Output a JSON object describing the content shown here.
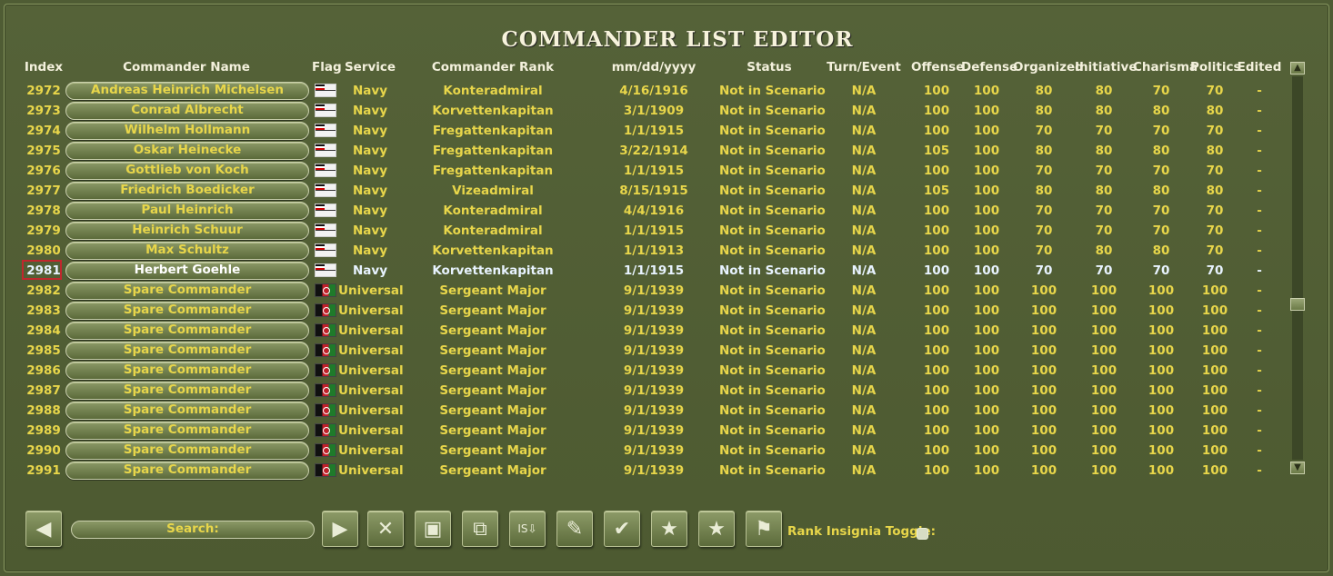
{
  "title": "COMMANDER LIST EDITOR",
  "columns": {
    "index": "Index",
    "name": "Commander Name",
    "flag": "Flag",
    "service": "Service",
    "rank": "Commander Rank",
    "date": "mm/dd/yyyy",
    "status": "Status",
    "turn": "Turn/Event",
    "offense": "Offense",
    "defense": "Defense",
    "organized": "Organized",
    "initiative": "Initiative",
    "charisma": "Charisma",
    "politics": "Politics",
    "edited": "Edited"
  },
  "selected_index": "2981",
  "rows": [
    {
      "index": "2972",
      "name": "Andreas Heinrich Michelsen",
      "flag": "navy",
      "service": "Navy",
      "rank": "Konteradmiral",
      "date": "4/16/1916",
      "status": "Not in Scenario",
      "turn": "N/A",
      "offense": "100",
      "defense": "100",
      "organized": "80",
      "initiative": "80",
      "charisma": "70",
      "politics": "70",
      "edited": "-"
    },
    {
      "index": "2973",
      "name": "Conrad Albrecht",
      "flag": "navy",
      "service": "Navy",
      "rank": "Korvettenkapitan",
      "date": "3/1/1909",
      "status": "Not in Scenario",
      "turn": "N/A",
      "offense": "100",
      "defense": "100",
      "organized": "80",
      "initiative": "80",
      "charisma": "80",
      "politics": "80",
      "edited": "-"
    },
    {
      "index": "2974",
      "name": "Wilhelm Hollmann",
      "flag": "navy",
      "service": "Navy",
      "rank": "Fregattenkapitan",
      "date": "1/1/1915",
      "status": "Not in Scenario",
      "turn": "N/A",
      "offense": "100",
      "defense": "100",
      "organized": "70",
      "initiative": "70",
      "charisma": "70",
      "politics": "70",
      "edited": "-"
    },
    {
      "index": "2975",
      "name": "Oskar Heinecke",
      "flag": "navy",
      "service": "Navy",
      "rank": "Fregattenkapitan",
      "date": "3/22/1914",
      "status": "Not in Scenario",
      "turn": "N/A",
      "offense": "105",
      "defense": "100",
      "organized": "80",
      "initiative": "80",
      "charisma": "80",
      "politics": "80",
      "edited": "-"
    },
    {
      "index": "2976",
      "name": "Gottlieb von Koch",
      "flag": "navy",
      "service": "Navy",
      "rank": "Fregattenkapitan",
      "date": "1/1/1915",
      "status": "Not in Scenario",
      "turn": "N/A",
      "offense": "100",
      "defense": "100",
      "organized": "70",
      "initiative": "70",
      "charisma": "70",
      "politics": "70",
      "edited": "-"
    },
    {
      "index": "2977",
      "name": "Friedrich Boedicker",
      "flag": "navy",
      "service": "Navy",
      "rank": "Vizeadmiral",
      "date": "8/15/1915",
      "status": "Not in Scenario",
      "turn": "N/A",
      "offense": "105",
      "defense": "100",
      "organized": "80",
      "initiative": "80",
      "charisma": "80",
      "politics": "80",
      "edited": "-"
    },
    {
      "index": "2978",
      "name": "Paul Heinrich",
      "flag": "navy",
      "service": "Navy",
      "rank": "Konteradmiral",
      "date": "4/4/1916",
      "status": "Not in Scenario",
      "turn": "N/A",
      "offense": "100",
      "defense": "100",
      "organized": "70",
      "initiative": "70",
      "charisma": "70",
      "politics": "70",
      "edited": "-"
    },
    {
      "index": "2979",
      "name": "Heinrich Schuur",
      "flag": "navy",
      "service": "Navy",
      "rank": "Konteradmiral",
      "date": "1/1/1915",
      "status": "Not in Scenario",
      "turn": "N/A",
      "offense": "100",
      "defense": "100",
      "organized": "70",
      "initiative": "70",
      "charisma": "70",
      "politics": "70",
      "edited": "-"
    },
    {
      "index": "2980",
      "name": "Max Schultz",
      "flag": "navy",
      "service": "Navy",
      "rank": "Korvettenkapitan",
      "date": "1/1/1913",
      "status": "Not in Scenario",
      "turn": "N/A",
      "offense": "100",
      "defense": "100",
      "organized": "70",
      "initiative": "80",
      "charisma": "80",
      "politics": "70",
      "edited": "-"
    },
    {
      "index": "2981",
      "name": "Herbert Goehle",
      "flag": "navy",
      "service": "Navy",
      "rank": "Korvettenkapitan",
      "date": "1/1/1915",
      "status": "Not in Scenario",
      "turn": "N/A",
      "offense": "100",
      "defense": "100",
      "organized": "70",
      "initiative": "70",
      "charisma": "70",
      "politics": "70",
      "edited": "-"
    },
    {
      "index": "2982",
      "name": "Spare Commander",
      "flag": "afg",
      "service": "Universal",
      "rank": "Sergeant Major",
      "date": "9/1/1939",
      "status": "Not in Scenario",
      "turn": "N/A",
      "offense": "100",
      "defense": "100",
      "organized": "100",
      "initiative": "100",
      "charisma": "100",
      "politics": "100",
      "edited": "-"
    },
    {
      "index": "2983",
      "name": "Spare Commander",
      "flag": "afg",
      "service": "Universal",
      "rank": "Sergeant Major",
      "date": "9/1/1939",
      "status": "Not in Scenario",
      "turn": "N/A",
      "offense": "100",
      "defense": "100",
      "organized": "100",
      "initiative": "100",
      "charisma": "100",
      "politics": "100",
      "edited": "-"
    },
    {
      "index": "2984",
      "name": "Spare Commander",
      "flag": "afg",
      "service": "Universal",
      "rank": "Sergeant Major",
      "date": "9/1/1939",
      "status": "Not in Scenario",
      "turn": "N/A",
      "offense": "100",
      "defense": "100",
      "organized": "100",
      "initiative": "100",
      "charisma": "100",
      "politics": "100",
      "edited": "-"
    },
    {
      "index": "2985",
      "name": "Spare Commander",
      "flag": "afg",
      "service": "Universal",
      "rank": "Sergeant Major",
      "date": "9/1/1939",
      "status": "Not in Scenario",
      "turn": "N/A",
      "offense": "100",
      "defense": "100",
      "organized": "100",
      "initiative": "100",
      "charisma": "100",
      "politics": "100",
      "edited": "-"
    },
    {
      "index": "2986",
      "name": "Spare Commander",
      "flag": "afg",
      "service": "Universal",
      "rank": "Sergeant Major",
      "date": "9/1/1939",
      "status": "Not in Scenario",
      "turn": "N/A",
      "offense": "100",
      "defense": "100",
      "organized": "100",
      "initiative": "100",
      "charisma": "100",
      "politics": "100",
      "edited": "-"
    },
    {
      "index": "2987",
      "name": "Spare Commander",
      "flag": "afg",
      "service": "Universal",
      "rank": "Sergeant Major",
      "date": "9/1/1939",
      "status": "Not in Scenario",
      "turn": "N/A",
      "offense": "100",
      "defense": "100",
      "organized": "100",
      "initiative": "100",
      "charisma": "100",
      "politics": "100",
      "edited": "-"
    },
    {
      "index": "2988",
      "name": "Spare Commander",
      "flag": "afg",
      "service": "Universal",
      "rank": "Sergeant Major",
      "date": "9/1/1939",
      "status": "Not in Scenario",
      "turn": "N/A",
      "offense": "100",
      "defense": "100",
      "organized": "100",
      "initiative": "100",
      "charisma": "100",
      "politics": "100",
      "edited": "-"
    },
    {
      "index": "2989",
      "name": "Spare Commander",
      "flag": "afg",
      "service": "Universal",
      "rank": "Sergeant Major",
      "date": "9/1/1939",
      "status": "Not in Scenario",
      "turn": "N/A",
      "offense": "100",
      "defense": "100",
      "organized": "100",
      "initiative": "100",
      "charisma": "100",
      "politics": "100",
      "edited": "-"
    },
    {
      "index": "2990",
      "name": "Spare Commander",
      "flag": "afg",
      "service": "Universal",
      "rank": "Sergeant Major",
      "date": "9/1/1939",
      "status": "Not in Scenario",
      "turn": "N/A",
      "offense": "100",
      "defense": "100",
      "organized": "100",
      "initiative": "100",
      "charisma": "100",
      "politics": "100",
      "edited": "-"
    },
    {
      "index": "2991",
      "name": "Spare Commander",
      "flag": "afg",
      "service": "Universal",
      "rank": "Sergeant Major",
      "date": "9/1/1939",
      "status": "Not in Scenario",
      "turn": "N/A",
      "offense": "100",
      "defense": "100",
      "organized": "100",
      "initiative": "100",
      "charisma": "100",
      "politics": "100",
      "edited": "-"
    }
  ],
  "toolbar": {
    "search_label": "Search:",
    "rank_insignia_label": "Rank Insignia Toggle:",
    "buttons": [
      {
        "name": "prev-button",
        "icon": "arrow-left-icon",
        "glyph": "◀"
      },
      {
        "name": "next-button",
        "icon": "arrow-right-icon",
        "glyph": "▶"
      },
      {
        "name": "delete-button",
        "icon": "x-icon",
        "glyph": "✕"
      },
      {
        "name": "copy-button",
        "icon": "copy-icon",
        "glyph": "▣"
      },
      {
        "name": "paste-button",
        "icon": "paste-icon",
        "glyph": "⧉"
      },
      {
        "name": "is-down-button",
        "icon": "is-arrow-icon",
        "glyph": "IS⇩"
      },
      {
        "name": "edit-button",
        "icon": "pen-icon",
        "glyph": "✎"
      },
      {
        "name": "confirm-button",
        "icon": "check-icon",
        "glyph": "✔"
      },
      {
        "name": "star-right-button",
        "icon": "star-arrow-right-icon",
        "glyph": "★"
      },
      {
        "name": "star-left-button",
        "icon": "star-arrow-left-icon",
        "glyph": "★"
      },
      {
        "name": "flag-button",
        "icon": "flag-icon",
        "glyph": "⚑"
      }
    ]
  },
  "colors": {
    "background": "#4f5c34",
    "text": "#e8d64a",
    "selected_text": "#e8f3ff",
    "selection_box": "#c1272d"
  }
}
